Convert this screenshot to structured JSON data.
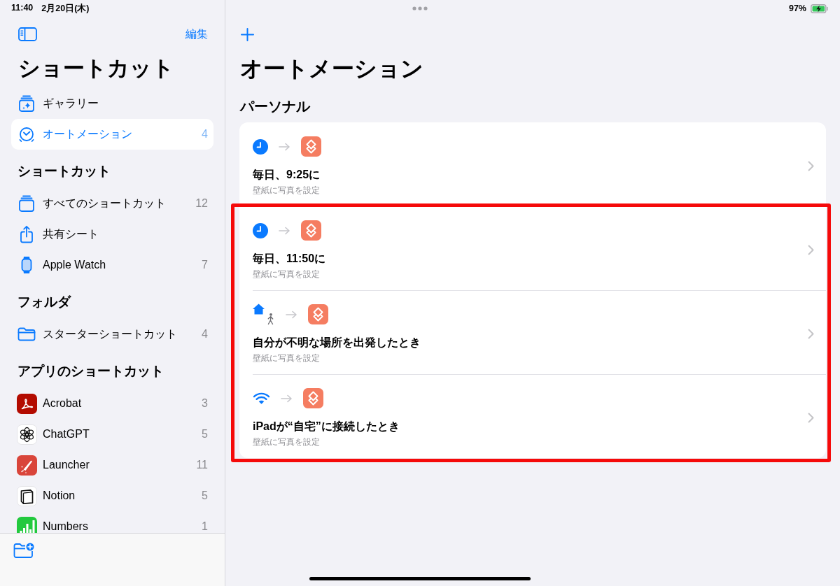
{
  "status_bar": {
    "time": "11:40",
    "date": "2月20日(木)",
    "battery": "97%",
    "charging": true
  },
  "sidebar": {
    "edit": "編集",
    "title": "ショートカット",
    "sections": [
      {
        "items": [
          {
            "kind": "gallery",
            "label": "ギャラリー",
            "selected": false
          },
          {
            "kind": "automation",
            "label": "オートメーション",
            "count": "4",
            "selected": true
          }
        ]
      },
      {
        "heading": "ショートカット",
        "items": [
          {
            "kind": "stack",
            "label": "すべてのショートカット",
            "count": "12",
            "selected": false
          },
          {
            "kind": "share",
            "label": "共有シート",
            "selected": false
          },
          {
            "kind": "watch",
            "label": "Apple Watch",
            "count": "7",
            "selected": false
          }
        ]
      },
      {
        "heading": "フォルダ",
        "items": [
          {
            "kind": "folder",
            "label": "スターターショートカット",
            "count": "4",
            "selected": false
          }
        ]
      },
      {
        "heading": "アプリのショートカット",
        "items": [
          {
            "kind": "swirl",
            "label": "Acrobat",
            "count": "3",
            "selected": false
          },
          {
            "kind": "knot",
            "label": "ChatGPT",
            "count": "5",
            "selected": false
          },
          {
            "kind": "rocket",
            "label": "Launcher",
            "count": "11",
            "selected": false
          },
          {
            "kind": "box",
            "label": "Notion",
            "count": "5",
            "selected": false
          },
          {
            "kind": "bars",
            "label": "Numbers",
            "count": "1",
            "selected": false
          }
        ]
      }
    ]
  },
  "main": {
    "title": "オートメーション",
    "section": "パーソナル",
    "automations": [
      {
        "kind": "time",
        "title": "毎日、9:25に",
        "subtitle": "壁紙に写真を設定",
        "highlighted": false
      },
      {
        "kind": "time",
        "title": "毎日、11:50に",
        "subtitle": "壁紙に写真を設定",
        "highlighted": true
      },
      {
        "kind": "leave",
        "title": "自分が不明な場所を出発したとき",
        "subtitle": "壁紙に写真を設定",
        "highlighted": true
      },
      {
        "kind": "wifi",
        "title": "iPadが“自宅”に接続したとき",
        "subtitle": "壁紙に写真を設定",
        "highlighted": true
      }
    ]
  }
}
